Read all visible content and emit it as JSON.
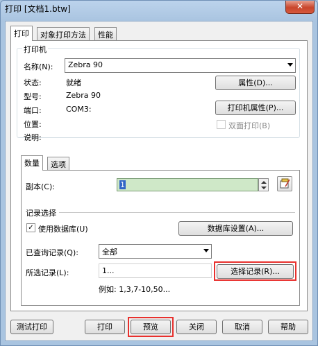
{
  "window": {
    "title": "打印 [文档1.btw]",
    "close_label": "✕"
  },
  "tabs": [
    "打印",
    "对象打印方法",
    "性能"
  ],
  "printer": {
    "group_label": "打印机",
    "name_label": "名称(N):",
    "name_value": "Zebra 90",
    "status_label": "状态:",
    "status_value": "就绪",
    "model_label": "型号:",
    "model_value": "Zebra 90",
    "port_label": "端口:",
    "port_value": "COM3:",
    "location_label": "位置:",
    "comment_label": "说明:",
    "properties_button": "属性(D)...",
    "printer_properties_button": "打印机属性(P)...",
    "duplex_label": "双面打印(B)"
  },
  "subtabs": [
    "数量",
    "选项"
  ],
  "quantity": {
    "copies_label": "副本(C):",
    "copies_value": "1"
  },
  "records": {
    "section_label": "记录选择",
    "use_database_label": "使用数据库(U)",
    "use_database_check": "✓",
    "database_settings_button": "数据库设置(A)...",
    "queried_label": "已查询记录(Q):",
    "queried_value": "全部",
    "selected_label": "所选记录(L):",
    "selected_value": "1...",
    "select_records_button": "选择记录(R)...",
    "example_text": "例如:  1,3,7-10,50..."
  },
  "footer": {
    "test_print": "测试打印",
    "print": "打印",
    "preview": "预览",
    "close": "关闭",
    "cancel": "取消",
    "help": "帮助"
  },
  "colors": {
    "highlight": "#e8302d",
    "spin_field": "#cfe8c8"
  }
}
